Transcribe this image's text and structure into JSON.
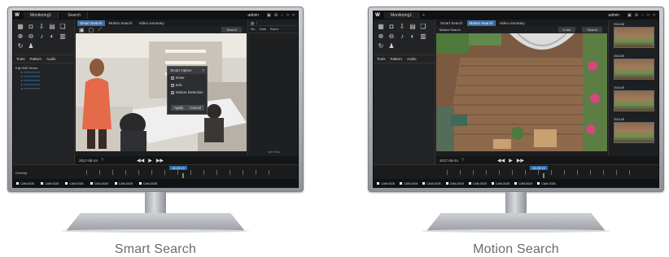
{
  "panels": [
    {
      "caption": "Smart Search",
      "app": {
        "tab1": "Monitoring1",
        "tab2": "Search",
        "user": "admin",
        "subtabs": [
          "Smart Search",
          "Motion Search",
          "Video summary"
        ],
        "search_button": "Search",
        "left_tabs": [
          "Tools",
          "Pattern",
          "Audio"
        ],
        "tree_root": "VMS Server",
        "date": "2017-08-24",
        "time_label": "15:25:13",
        "pager": "0 / 0"
      },
      "dialog": {
        "title": "Smart Option",
        "options": [
          "Enter",
          "Exit",
          "Motion Detection"
        ],
        "apply": "Apply",
        "cancel": "Cancel"
      },
      "channels": [
        "CAM-0028",
        "CAM-0028",
        "CAM-0028",
        "CAM-0028",
        "CAM-0028",
        "CAM-0028"
      ]
    },
    {
      "caption": "Motion Search",
      "app": {
        "tab1": "Monitoring1",
        "tab2": "+",
        "user": "admin",
        "subtabs": [
          "Smart Search",
          "Motion Search",
          "Video summary"
        ],
        "select_label": "Motion Search",
        "select_value": "5 min",
        "search_button": "Search",
        "left_tabs": [
          "Tools",
          "Pattern",
          "Audio"
        ],
        "date": "2017-08-24",
        "time_label": "15:25:13"
      },
      "thumb_labels": [
        "2018-08",
        "2018-08",
        "2018-08",
        "2018-08"
      ],
      "channels": [
        "CAM-0028",
        "CAM-0028",
        "CAM-0028",
        "CAM-0028",
        "CAM-0028",
        "CAM-0028",
        "CAM-0028",
        "CAM-0028"
      ]
    }
  ]
}
